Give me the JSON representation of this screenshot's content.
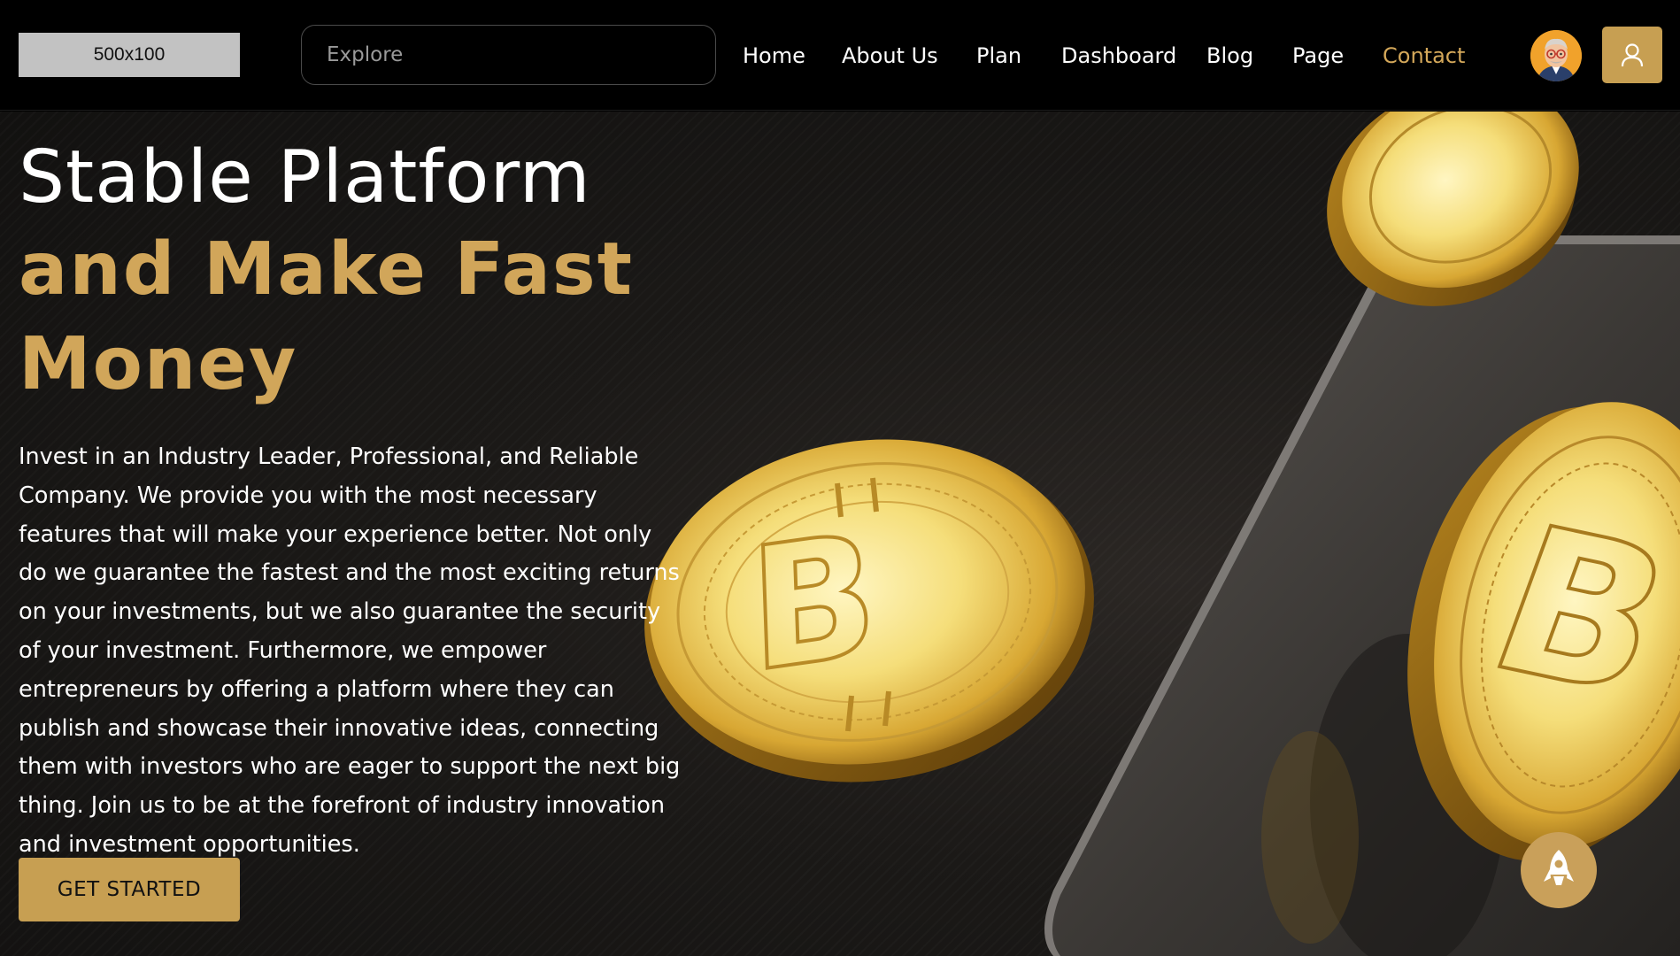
{
  "header": {
    "logo_text": "500x100",
    "search_placeholder": "Explore",
    "nav": [
      {
        "label": "Home"
      },
      {
        "label": "About Us"
      },
      {
        "label": "Plan"
      },
      {
        "label": "Dashboard"
      },
      {
        "label": "Blog"
      },
      {
        "label": "Page"
      },
      {
        "label": "Contact",
        "active": true
      }
    ],
    "avatar_icon": "user-avatar-illustration",
    "account_icon": "user-icon"
  },
  "hero": {
    "title_line1": "Stable Platform",
    "title_line2": "and Make Fast",
    "title_line3": "Money",
    "description": "Invest in an Industry Leader, Professional, and Reliable Company. We provide you with the most necessary features that will make your experience better. Not only do we guarantee the fastest and the most exciting returns on your investments, but we also guarantee the security of your investment. Furthermore, we empower entrepreneurs by offering a platform where they can publish and showcase their innovative ideas, connecting them with investors who are eager to support the next big thing. Join us to be at the forefront of industry innovation and investment opportunities.",
    "cta_label": "GET STARTED",
    "image": "gold-bitcoin-coins",
    "floating_icon": "rocket-icon"
  },
  "colors": {
    "accent": "#c79f52",
    "title_gold": "#d1a65a",
    "background": "#000000",
    "active_nav": "#d4a85a"
  }
}
